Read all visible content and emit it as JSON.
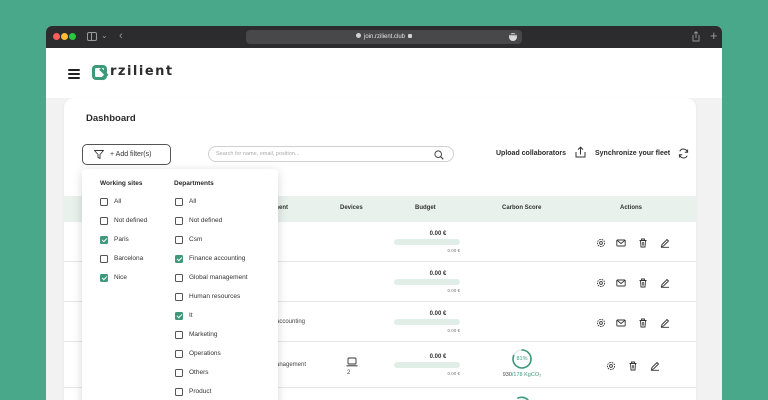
{
  "browser": {
    "url": "join.rzilient.club"
  },
  "app": {
    "brand": "rzilient",
    "page_title": "Dashboard"
  },
  "toolbar": {
    "filter_label": "+ Add filter(s)",
    "search_placeholder": "Search for name, email, position...",
    "upload_label": "Upload collaborators",
    "sync_label": "Synchronize your fleet"
  },
  "table": {
    "headers": {
      "department": "artment",
      "devices": "Devices",
      "budget": "Budget",
      "carbon": "Carbon Score",
      "actions": "Actions"
    },
    "rows": [
      {
        "department": "t",
        "budget": "0.00 €",
        "budget_sub": "0.00 €"
      },
      {
        "department": "t",
        "budget": "0.00 €",
        "budget_sub": "0.00 €"
      },
      {
        "department": "accounting",
        "budget": "0.00 €",
        "budget_sub": "0.00 €"
      },
      {
        "department": "anagement",
        "devices": "2",
        "budget": "0.00 €",
        "budget_sub": "0.00 €",
        "carbon_pct": "81%",
        "carbon_value": "930",
        "carbon_target": "/178 KgCO₂",
        "carbon_score": 0.81
      }
    ]
  },
  "filters": {
    "working_sites_title": "Working sites",
    "departments_title": "Departments",
    "working_sites": [
      {
        "label": "All",
        "checked": false
      },
      {
        "label": "Not defined",
        "checked": false
      },
      {
        "label": "Paris",
        "checked": true
      },
      {
        "label": "Barcelona",
        "checked": false
      },
      {
        "label": "Nice",
        "checked": true
      }
    ],
    "departments": [
      {
        "label": "All",
        "checked": false
      },
      {
        "label": "Not defined",
        "checked": false
      },
      {
        "label": "Csm",
        "checked": false
      },
      {
        "label": "Finance accounting",
        "checked": true
      },
      {
        "label": "Global management",
        "checked": false
      },
      {
        "label": "Human resources",
        "checked": false
      },
      {
        "label": "It",
        "checked": true
      },
      {
        "label": "Marketing",
        "checked": false
      },
      {
        "label": "Operations",
        "checked": false
      },
      {
        "label": "Others",
        "checked": false
      },
      {
        "label": "Product",
        "checked": false
      }
    ]
  },
  "colors": {
    "accent": "#3c9a7a",
    "background": "#4aa88a",
    "header_row": "#e8f1ec"
  }
}
